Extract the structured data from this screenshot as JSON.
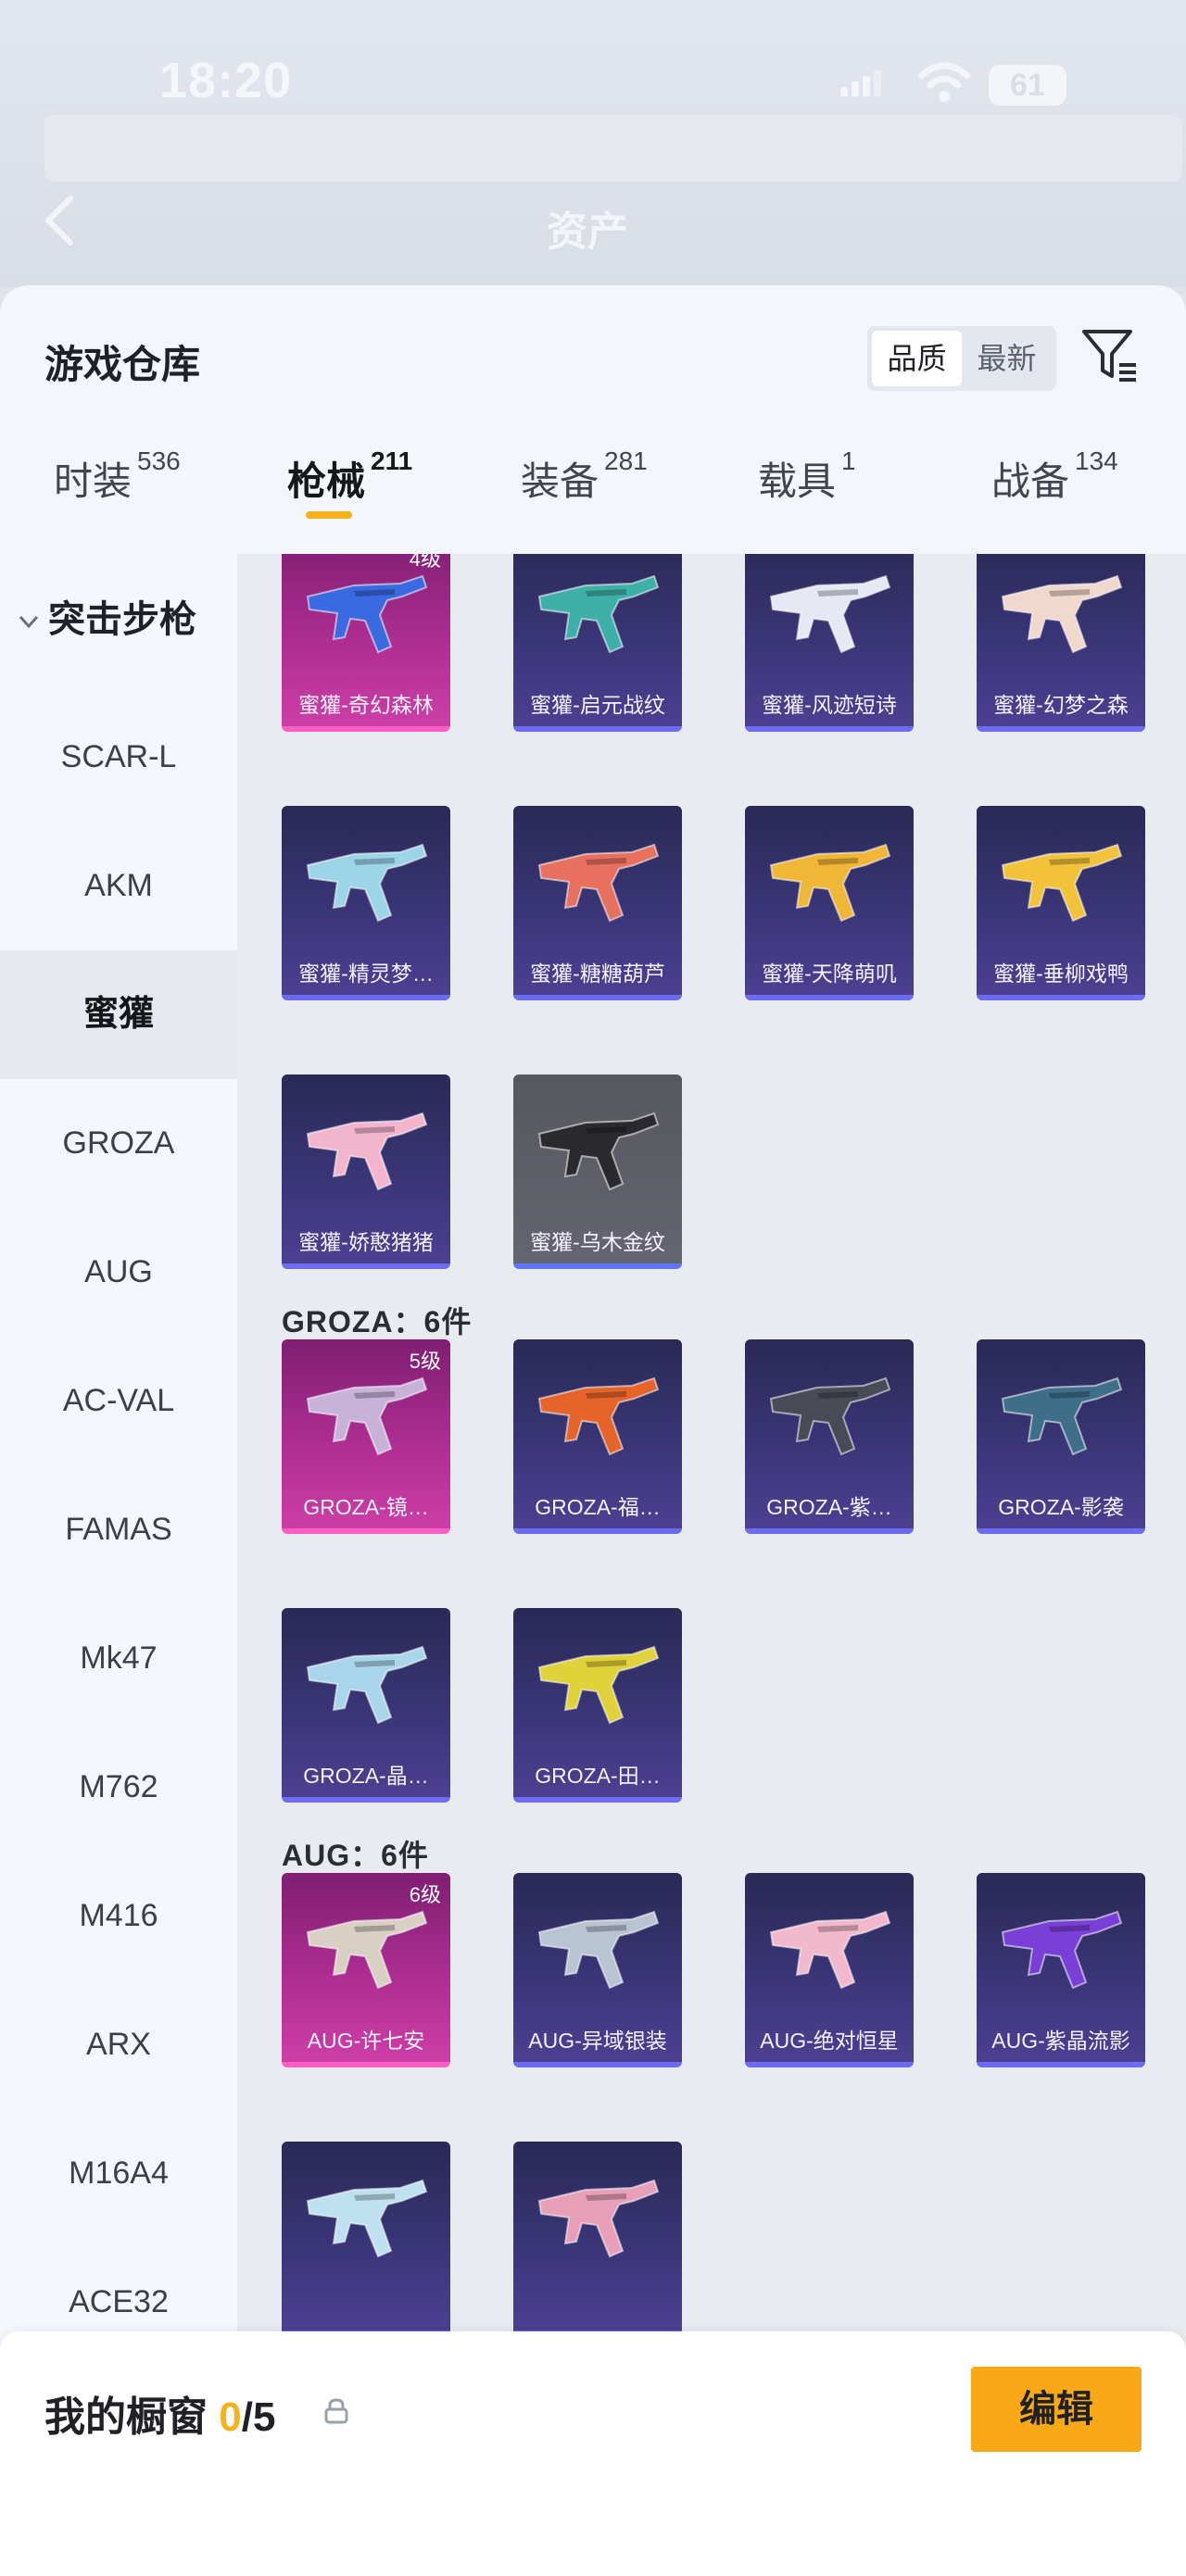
{
  "status_bar": {
    "time": "18:20",
    "battery": "61"
  },
  "header": {
    "title": "资产"
  },
  "panel": {
    "title": "游戏仓库",
    "sort_options": [
      "品质",
      "最新"
    ],
    "sort_selected": "品质"
  },
  "tabs": [
    {
      "label": "时装",
      "count": "536"
    },
    {
      "label": "枪械",
      "count": "211"
    },
    {
      "label": "装备",
      "count": "281"
    },
    {
      "label": "载具",
      "count": "1"
    },
    {
      "label": "战备",
      "count": "134"
    }
  ],
  "active_tab": "枪械",
  "sidebar": {
    "group": "突击步枪",
    "items": [
      "SCAR-L",
      "AKM",
      "蜜獾",
      "GROZA",
      "AUG",
      "AC-VAL",
      "FAMAS",
      "Mk47",
      "M762",
      "M416",
      "ARX",
      "M16A4",
      "ACE32"
    ],
    "selected": "蜜獾"
  },
  "sections": [
    {
      "title": "",
      "items": [
        {
          "name": "蜜獾-奇幻森林",
          "level": "4级",
          "rarity": "legendary",
          "color": "#3a6ae0"
        },
        {
          "name": "蜜獾-启元战纹",
          "level": "",
          "rarity": "epic",
          "color": "#3fb0a8"
        },
        {
          "name": "蜜獾-风迹短诗",
          "level": "",
          "rarity": "epic",
          "color": "#e6e9f4"
        },
        {
          "name": "蜜獾-幻梦之森",
          "level": "",
          "rarity": "epic",
          "color": "#f0d8cc"
        },
        {
          "name": "蜜獾-精灵梦…",
          "level": "",
          "rarity": "epic",
          "color": "#9cd4e8"
        },
        {
          "name": "蜜獾-糖糖葫芦",
          "level": "",
          "rarity": "epic",
          "color": "#e8705e"
        },
        {
          "name": "蜜獾-天降萌叽",
          "level": "",
          "rarity": "epic",
          "color": "#f0b636"
        },
        {
          "name": "蜜獾-垂柳戏鸭",
          "level": "",
          "rarity": "epic",
          "color": "#f2c23a"
        },
        {
          "name": "蜜獾-娇憨猪猪",
          "level": "",
          "rarity": "epic",
          "color": "#f2b5cc"
        },
        {
          "name": "蜜獾-乌木金纹",
          "level": "",
          "rarity": "rare",
          "color": "#2a2a2e"
        }
      ]
    },
    {
      "title": "GROZA：6件",
      "items": [
        {
          "name": "GROZA-镜…",
          "level": "5级",
          "rarity": "legendary",
          "color": "#c7b2d8"
        },
        {
          "name": "GROZA-福…",
          "level": "",
          "rarity": "epic",
          "color": "#e4642a"
        },
        {
          "name": "GROZA-紫…",
          "level": "",
          "rarity": "epic",
          "color": "#4a4a56"
        },
        {
          "name": "GROZA-影袭",
          "level": "",
          "rarity": "epic",
          "color": "#3e6e88"
        },
        {
          "name": "GROZA-晶…",
          "level": "",
          "rarity": "epic",
          "color": "#a9d6ea"
        },
        {
          "name": "GROZA-田…",
          "level": "",
          "rarity": "epic",
          "color": "#e0d23a"
        }
      ]
    },
    {
      "title": "AUG：6件",
      "items": [
        {
          "name": "AUG-许七安",
          "level": "6级",
          "rarity": "legendary",
          "color": "#d9d0c4"
        },
        {
          "name": "AUG-异域银装",
          "level": "",
          "rarity": "epic",
          "color": "#b9c4d2"
        },
        {
          "name": "AUG-绝对恒星",
          "level": "",
          "rarity": "epic",
          "color": "#f2b8cc"
        },
        {
          "name": "AUG-紫晶流影",
          "level": "",
          "rarity": "epic",
          "color": "#7a3fd6"
        },
        {
          "name": "",
          "level": "",
          "rarity": "epic",
          "color": "#bfe0f0"
        },
        {
          "name": "",
          "level": "",
          "rarity": "epic",
          "color": "#e7a0b8"
        }
      ]
    }
  ],
  "showcase": {
    "label": "我的橱窗",
    "count": "0",
    "total": "/5",
    "edit_label": "编辑"
  }
}
